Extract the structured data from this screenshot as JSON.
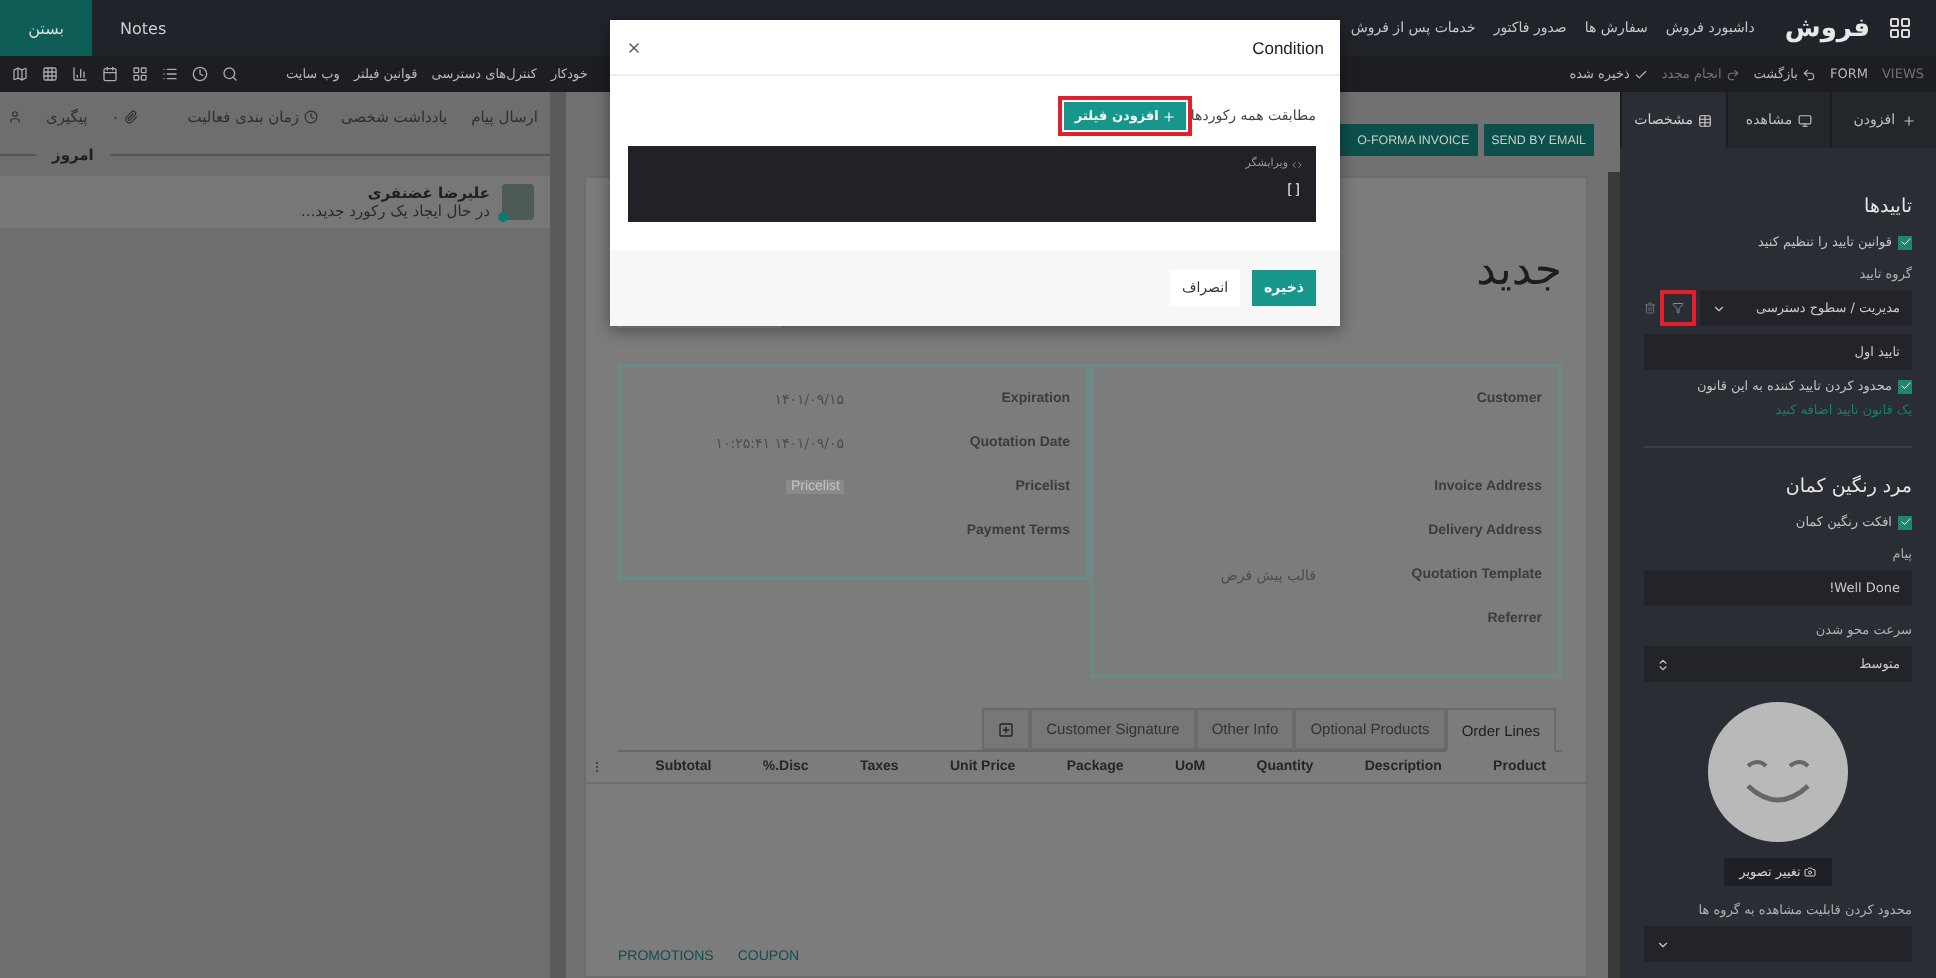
{
  "top_bar": {
    "app_title": "فروش",
    "menu": [
      "داشبورد فروش",
      "سفارش ها",
      "صدور فاکتور",
      "خدمات پس از فروش"
    ],
    "notes": "Notes",
    "close": "بستن"
  },
  "toolbar": {
    "views": "VIEWS",
    "form": "FORM",
    "undo": "بازگشت",
    "redo": "انجام مجدد",
    "saved": "ذخیره شده",
    "links": [
      "خودکار",
      "کنترل‌های دسترسی",
      "قوانین فیلتر",
      "وب سایت"
    ]
  },
  "chatter": {
    "actions": [
      "ارسال پیام",
      "یادداشت شخصی",
      "زمان بندی فعالیت"
    ],
    "attachments": "۰",
    "follow": "پیگیری",
    "divider": "امروز",
    "messages": [
      {
        "author": "علیرضا غضنفری",
        "body": "در حال ایجاد یک رکورد جدید..."
      }
    ]
  },
  "form": {
    "buttons": [
      "SEND BY EMAIL",
      "O-FORMA INVOICE"
    ],
    "title": "جدید",
    "left_group": [
      {
        "label": "Expiration",
        "value": "۱۴۰۱/۰۹/۱۵"
      },
      {
        "label": "Quotation Date",
        "value": "۱۰:۲۵:۴۱ ۱۴۰۱/۰۹/۰۵"
      },
      {
        "label": "Pricelist",
        "placeholder": "Pricelist"
      },
      {
        "label": "Payment Terms"
      }
    ],
    "right_group": [
      {
        "label": "Customer"
      },
      {
        "label": "Invoice Address"
      },
      {
        "label": "Delivery Address"
      },
      {
        "label": "Quotation Template",
        "value": "قالب پیش فرض"
      },
      {
        "label": "Referrer"
      }
    ],
    "tabs": [
      {
        "label": "Order Lines",
        "selected": true
      },
      {
        "label": "Optional Products",
        "selected": false
      },
      {
        "label": "Other Info",
        "selected": false
      },
      {
        "label": "Customer Signature",
        "selected": false
      }
    ],
    "columns": [
      "Product",
      "Description",
      "Quantity",
      "UoM",
      "Package",
      "Unit Price",
      "Taxes",
      "%.Disc",
      "Subtotal"
    ],
    "links": [
      "COUPON",
      "PROMOTIONS"
    ]
  },
  "sidebar": {
    "tabs": [
      {
        "label": "افزودن",
        "selected": false
      },
      {
        "label": "مشاهده",
        "selected": false
      },
      {
        "label": "مشخصات",
        "selected": true
      }
    ],
    "approvals": {
      "title": "تاییدها",
      "rules_label": "قوانین تایید را تنظیم کنید",
      "rules_checked": true,
      "group_label": "گروه تایید",
      "group_value": "مدیریت / سطوح دسترسی",
      "filter_highlighted": true,
      "rule_name": "تایید اول",
      "limit_label": "محدود کردن تایید کننده به این قانون",
      "limit_checked": true,
      "add_rule": "یک قانون تایید اضافه کنید"
    },
    "rainbow": {
      "title": "مرد رنگین کمان",
      "effect_label": "افکت رنگین کمان",
      "effect_checked": true,
      "message_label": "پیام",
      "message": "Well Done!",
      "fade_label": "سرعت محو شدن",
      "fade_value": "متوسط",
      "change_image": "تغییر تصویر",
      "groups_label": "محدود کردن قابلیت مشاهده به گروه ها"
    }
  },
  "modal": {
    "title": "Condition",
    "match_text": "مطابقت همه رکوردها",
    "add_filter": "افزودن فیلتر",
    "add_filter_highlighted": true,
    "editor_label": "ویرایشگر",
    "domain": "[]",
    "save": "ذخیره",
    "cancel": "انصراف"
  }
}
